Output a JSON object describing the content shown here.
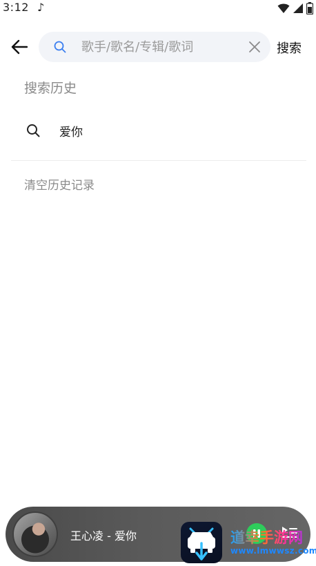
{
  "status_bar": {
    "time": "3:12",
    "music_glyph": "♪",
    "icons": [
      "wifi-icon",
      "cellular-icon",
      "battery-icon"
    ]
  },
  "header": {
    "back_icon": "arrow-left-icon",
    "search": {
      "placeholder": "歌手/歌名/专辑/歌词",
      "value": "",
      "icon": "search-icon",
      "clear_icon": "close-icon"
    },
    "submit_label": "搜索"
  },
  "history": {
    "title": "搜索历史",
    "items": [
      {
        "icon": "search-icon",
        "label": "爱你"
      }
    ],
    "clear_label": "清空历史记录"
  },
  "mini_player": {
    "track_title": "王心凌 - 爱你",
    "play_pause_icon": "pause-icon",
    "playlist_icon": "playlist-icon"
  },
  "watermark": {
    "text": "道幸手游网",
    "url": "www.lmwwsz.com"
  },
  "colors": {
    "accent_green": "#2ecc5b",
    "search_bg": "#f2f4f8",
    "muted_text": "#8a8a8a"
  }
}
